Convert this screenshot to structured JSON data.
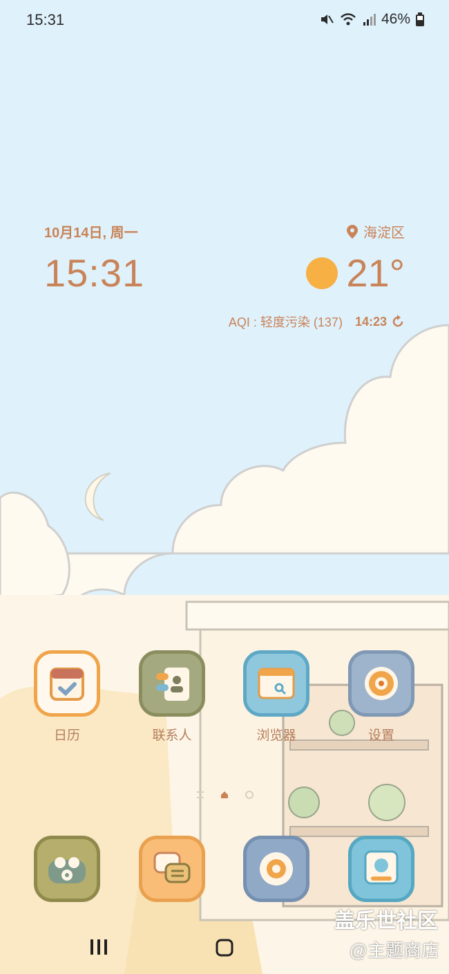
{
  "status_bar": {
    "time": "15:31",
    "battery": "46%"
  },
  "widget": {
    "date": "10月14日, 周一",
    "clock": "15:31",
    "location": "海淀区",
    "temperature": "21°",
    "aqi": "AQI : 轻度污染 (137)",
    "updated": "14:23"
  },
  "apps_row1": [
    {
      "label": "日历"
    },
    {
      "label": "联系人"
    },
    {
      "label": "浏览器"
    },
    {
      "label": "设置"
    }
  ],
  "watermark": {
    "line1": "盖乐世社区",
    "line2": "@主题商店"
  },
  "colors": {
    "sky": "#dff1fb",
    "accent": "#c98358",
    "sun": "#f6b043"
  }
}
